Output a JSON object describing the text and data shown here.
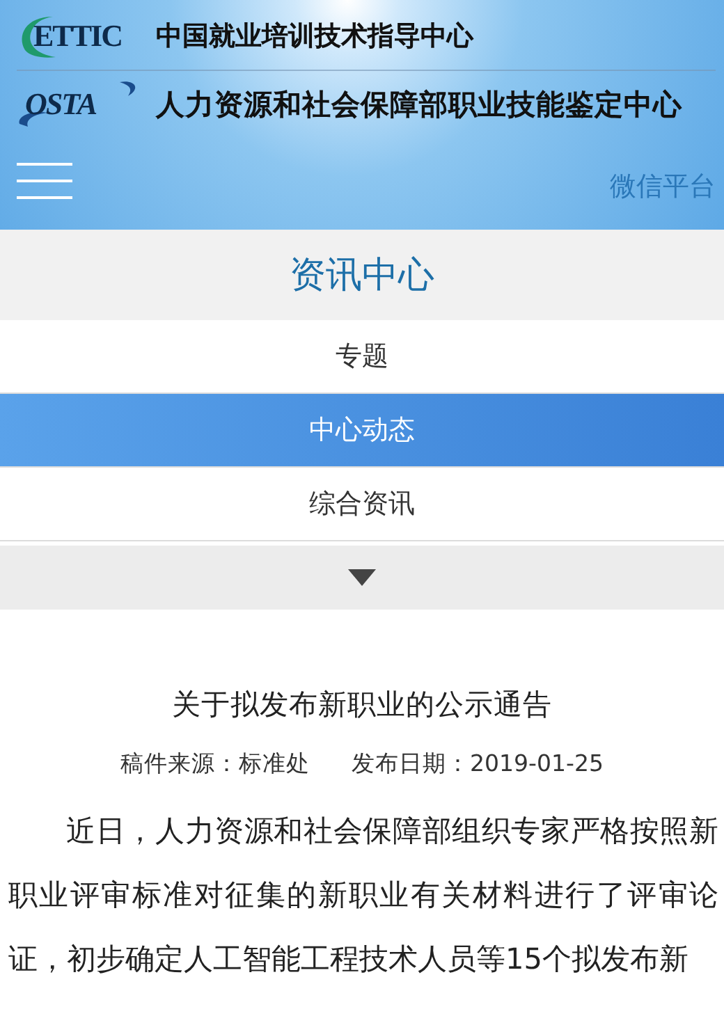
{
  "header": {
    "logos": [
      {
        "kind": "arc",
        "mark": "ETTIC",
        "name": "中国就业培训技术指导中心"
      },
      {
        "kind": "swoosh",
        "mark": "OSTA",
        "name": "人力资源和社会保障部职业技能鉴定中心"
      }
    ],
    "link": "微信平台"
  },
  "section": {
    "title": "资讯中心",
    "items": [
      {
        "label": "专题",
        "selected": false
      },
      {
        "label": "中心动态",
        "selected": true
      },
      {
        "label": "综合资讯",
        "selected": false
      }
    ]
  },
  "article": {
    "title": "关于拟发布新职业的公示通告",
    "source": "稿件来源：标准处",
    "date": "发布日期：2019-01-25",
    "body": "近日，人力资源和社会保障部组织专家严格按照新职业评审标准对征集的新职业有关材料进行了评审论证，初步确定人工智能工程技术人员等15个拟发布新"
  }
}
